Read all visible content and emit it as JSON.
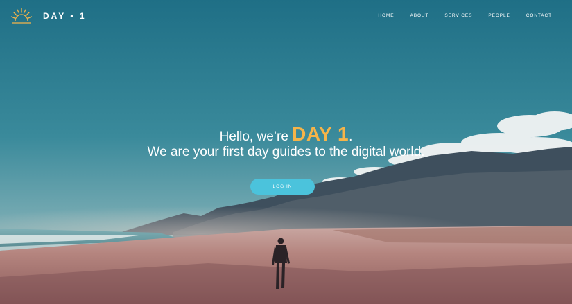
{
  "brand": {
    "logo_text": "DAY • 1",
    "logo_icon": "sunrise-icon",
    "accent_color": "#f5b449"
  },
  "nav": {
    "items": [
      {
        "label": "HOME"
      },
      {
        "label": "ABOUT"
      },
      {
        "label": "SERVICES"
      },
      {
        "label": "PEOPLE"
      },
      {
        "label": "CONTACT"
      }
    ]
  },
  "hero": {
    "greeting_prefix": "Hello, we’re ",
    "greeting_brand": "DAY 1",
    "greeting_suffix": ".",
    "tagline": "We are your first day guides to the digital world.",
    "login_label": "LOG IN",
    "login_color": "#4bc3dc"
  }
}
